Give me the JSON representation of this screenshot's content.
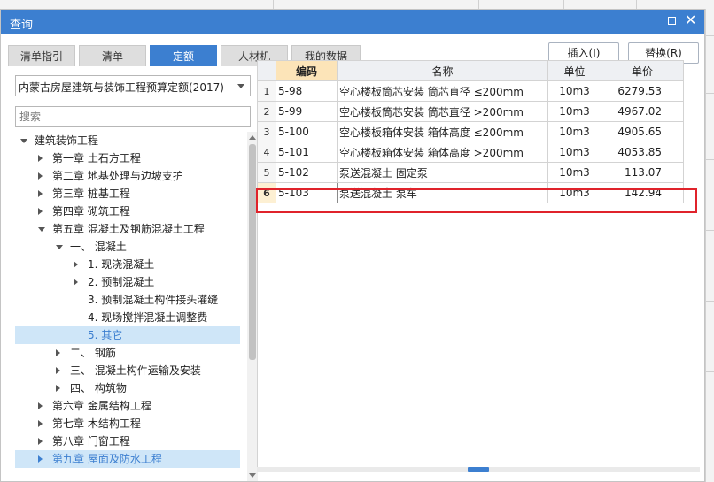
{
  "window": {
    "title": "查询"
  },
  "tabs": [
    {
      "label": "清单指引",
      "active": false
    },
    {
      "label": "清单",
      "active": false
    },
    {
      "label": "定额",
      "active": true
    },
    {
      "label": "人材机",
      "active": false
    },
    {
      "label": "我的数据",
      "active": false
    }
  ],
  "actions": {
    "insert_label": "插入(I)",
    "replace_label": "替换(R)"
  },
  "quota_library": {
    "selected": "内蒙古房屋建筑与装饰工程预算定额(2017)"
  },
  "search": {
    "placeholder": "搜索",
    "value": ""
  },
  "tree": [
    {
      "label": "建筑装饰工程",
      "level": 0,
      "state": "expanded"
    },
    {
      "label": "第一章 土石方工程",
      "level": 1,
      "state": "collapsed"
    },
    {
      "label": "第二章 地基处理与边坡支护",
      "level": 1,
      "state": "collapsed"
    },
    {
      "label": "第三章 桩基工程",
      "level": 1,
      "state": "collapsed"
    },
    {
      "label": "第四章 砌筑工程",
      "level": 1,
      "state": "collapsed"
    },
    {
      "label": "第五章 混凝土及钢筋混凝土工程",
      "level": 1,
      "state": "expanded"
    },
    {
      "label": "一、 混凝土",
      "level": 2,
      "state": "expanded"
    },
    {
      "label": "1. 现浇混凝土",
      "level": 3,
      "state": "collapsed"
    },
    {
      "label": "2. 预制混凝土",
      "level": 3,
      "state": "collapsed"
    },
    {
      "label": "3. 预制混凝土构件接头灌缝",
      "level": 3,
      "state": "leaf"
    },
    {
      "label": "4. 现场搅拌混凝土调整费",
      "level": 3,
      "state": "leaf"
    },
    {
      "label": "5. 其它",
      "level": 3,
      "state": "leaf",
      "selected": true
    },
    {
      "label": "二、 钢筋",
      "level": 2,
      "state": "collapsed"
    },
    {
      "label": "三、 混凝土构件运输及安装",
      "level": 2,
      "state": "collapsed"
    },
    {
      "label": "四、 构筑物",
      "level": 2,
      "state": "collapsed"
    },
    {
      "label": "第六章 金属结构工程",
      "level": 1,
      "state": "collapsed"
    },
    {
      "label": "第七章 木结构工程",
      "level": 1,
      "state": "collapsed"
    },
    {
      "label": "第八章 门窗工程",
      "level": 1,
      "state": "collapsed"
    },
    {
      "label": "第九章 屋面及防水工程",
      "level": 1,
      "state": "collapsed",
      "hover": true
    }
  ],
  "grid": {
    "columns": [
      "编码",
      "名称",
      "单位",
      "单价"
    ],
    "rows": [
      {
        "no": "1",
        "code": "5-98",
        "name": "空心楼板筒芯安装 筒芯直径 ≤200mm",
        "unit": "10m3",
        "price": "6279.53"
      },
      {
        "no": "2",
        "code": "5-99",
        "name": "空心楼板筒芯安装 筒芯直径 >200mm",
        "unit": "10m3",
        "price": "4967.02"
      },
      {
        "no": "3",
        "code": "5-100",
        "name": "空心楼板箱体安装 箱体高度 ≤200mm",
        "unit": "10m3",
        "price": "4905.65"
      },
      {
        "no": "4",
        "code": "5-101",
        "name": "空心楼板箱体安装 箱体高度 >200mm",
        "unit": "10m3",
        "price": "4053.85"
      },
      {
        "no": "5",
        "code": "5-102",
        "name": "泵送混凝土 固定泵",
        "unit": "10m3",
        "price": "113.07"
      },
      {
        "no": "6",
        "code": "5-103",
        "name": "泵送混凝土 泵车",
        "unit": "10m3",
        "price": "142.94",
        "current": true
      }
    ]
  },
  "colors": {
    "accent": "#3c7fd0",
    "highlight_border": "#e0232b",
    "selected_row_bg": "#cfe6f8"
  }
}
